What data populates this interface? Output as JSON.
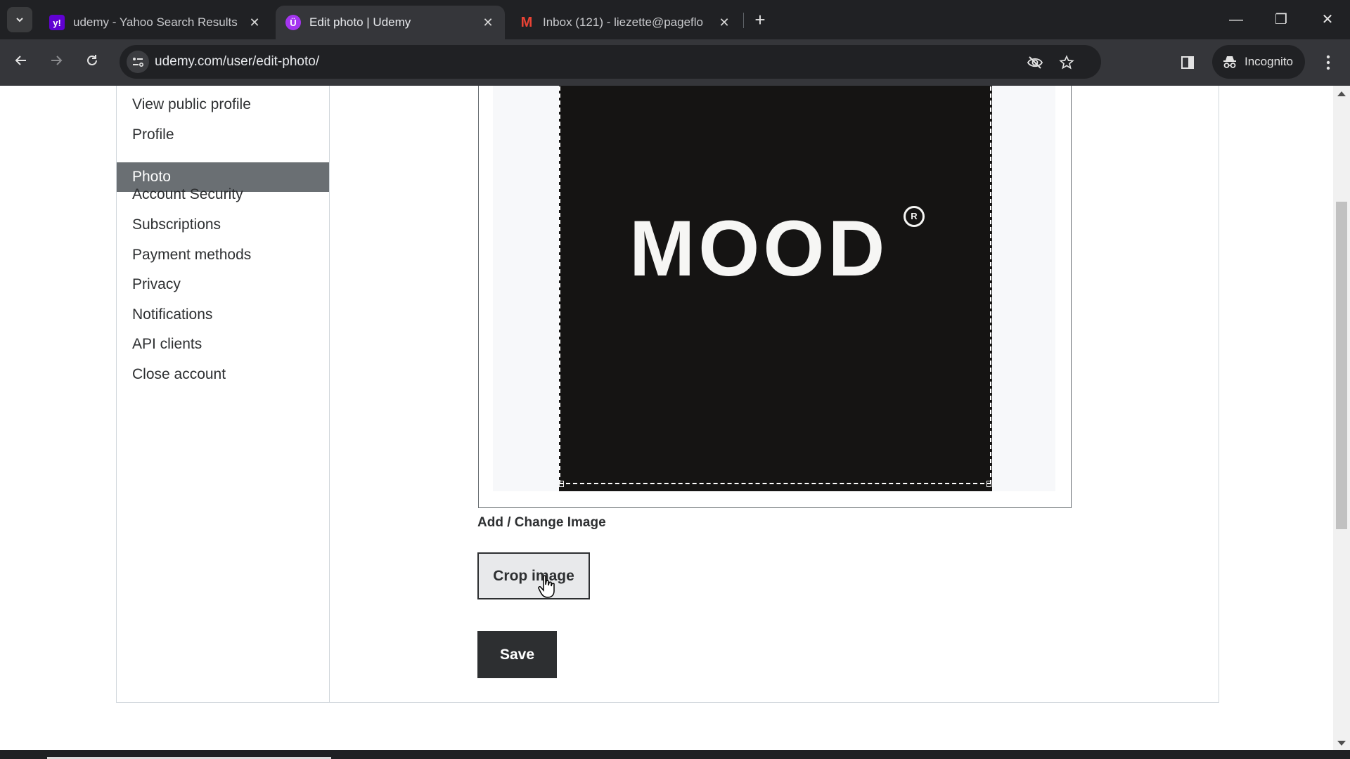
{
  "browser": {
    "tabs": [
      {
        "title": "udemy - Yahoo Search Results",
        "favicon": "yahoo-icon",
        "favicon_color": "#6001d2",
        "favicon_glyph": "y!",
        "active": false
      },
      {
        "title": "Edit photo | Udemy",
        "favicon": "udemy-icon",
        "favicon_color": "#a435f0",
        "favicon_glyph": "Ü",
        "active": true
      },
      {
        "title": "Inbox (121) - liezette@pageflo",
        "favicon": "gmail-icon",
        "favicon_color": "#ea4335",
        "favicon_glyph": "M",
        "active": false
      }
    ],
    "close_glyph": "✕",
    "new_tab_glyph": "+",
    "url": "udemy.com/user/edit-photo/",
    "incognito_label": "Incognito",
    "window_controls": {
      "minimize": "—",
      "restore": "❐",
      "close": "✕"
    }
  },
  "sidebar": {
    "items": [
      {
        "label": "View public profile",
        "active": false
      },
      {
        "label": "Profile",
        "active": false
      },
      {
        "label": "Photo",
        "active": true
      },
      {
        "label": "Account Security",
        "active": false
      },
      {
        "label": "Subscriptions",
        "active": false
      },
      {
        "label": "Payment methods",
        "active": false
      },
      {
        "label": "Privacy",
        "active": false
      },
      {
        "label": "Notifications",
        "active": false
      },
      {
        "label": "API clients",
        "active": false
      },
      {
        "label": "Close account",
        "active": false
      }
    ]
  },
  "photo": {
    "logo_text": "MOOD",
    "logo_mark": "R"
  },
  "form": {
    "section_label": "Add / Change Image",
    "crop_button": "Crop image",
    "save_button": "Save"
  },
  "colors": {
    "active_nav": "#6a6f73",
    "primary_dark": "#2d2f31",
    "crop_button_bg": "#e8e9eb"
  }
}
